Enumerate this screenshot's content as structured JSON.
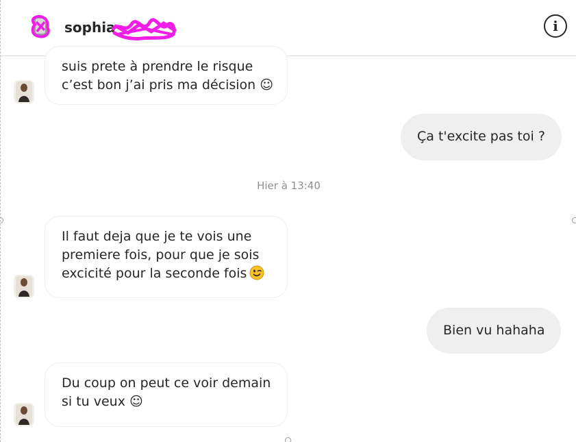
{
  "header": {
    "username": "sophia",
    "info_icon": "info-icon",
    "info_glyph": "i",
    "avatar_icon": "profile-avatar"
  },
  "messages": [
    {
      "direction": "incoming",
      "lines": [
        "suis prete à prendre le risque",
        "c’est bon j’ai pris ma décision ☺"
      ]
    },
    {
      "direction": "outgoing",
      "text": "Ça t'excite pas toi ?"
    },
    {
      "direction": "incoming",
      "lines": [
        "Il faut deja que je te vois une",
        "premiere fois, pour que je sois",
        "excicité pour la seconde fois"
      ],
      "emoji": "winking-face-emoji"
    },
    {
      "direction": "outgoing",
      "text": "Bien vu hahaha"
    },
    {
      "direction": "incoming",
      "lines": [
        "Du coup on peut ce voir demain",
        "si tu veux ☺"
      ]
    }
  ],
  "timestamp": "Hier à 13:40",
  "colors": {
    "redaction": "#f01ee6",
    "outgoing_bubble": "#efefef",
    "incoming_border": "#efefef",
    "timestamp": "#8e8e8e",
    "text": "#262626"
  }
}
